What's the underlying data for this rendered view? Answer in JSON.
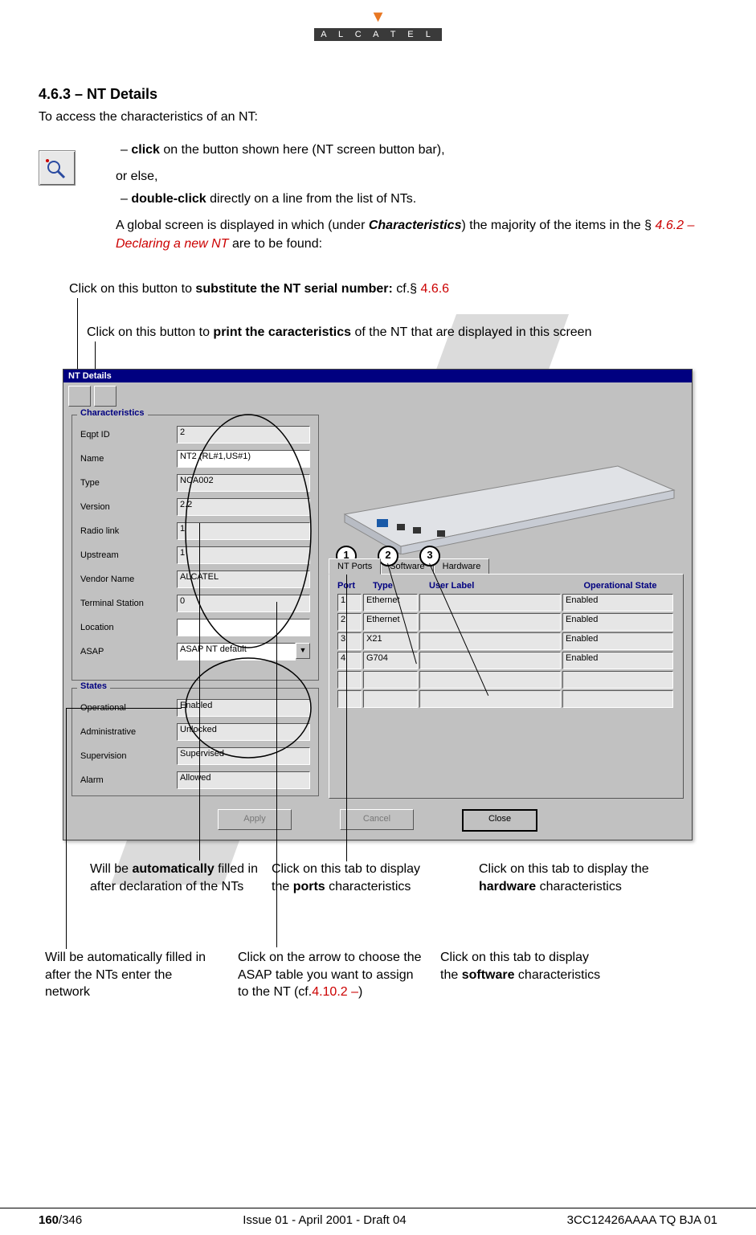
{
  "brand": "A L C A T E L",
  "section_number": "4.6.3 –  NT Details",
  "intro": "To access the characteristics of an NT:",
  "bullets": {
    "b1_prefix": "click",
    "b1_rest": " on the button shown here (NT screen button bar),",
    "or_else": "or else,",
    "b2_prefix": "double-click",
    "b2_rest": " directly on a line from the list of NTs."
  },
  "global_text_pre": "A global screen is displayed in which (under ",
  "global_text_bolditalic": "Characteristics",
  "global_text_mid": ") the majority of the items in the § ",
  "global_text_ref": "4.6.2 – Declaring a new NT",
  "global_text_post": " are to be found:",
  "callout_top1_pre": "Click on this button to ",
  "callout_top1_bold": "substitute the NT serial number:",
  "callout_top1_post": " cf.§ ",
  "callout_top1_ref": "4.6.6",
  "callout_top2_pre": "Click on this button to ",
  "callout_top2_bold": "print the caracteristics",
  "callout_top2_post": " of the NT that are displayed in this screen",
  "window": {
    "title": "NT Details",
    "characteristics_label": "Characteristics",
    "states_label": "States",
    "fields": {
      "eqpt_id": {
        "label": "Eqpt ID",
        "value": "2"
      },
      "name": {
        "label": "Name",
        "value": "NT2 (RL#1,US#1)"
      },
      "type": {
        "label": "Type",
        "value": "NCA002"
      },
      "version": {
        "label": "Version",
        "value": "2.2"
      },
      "radio_link": {
        "label": "Radio link",
        "value": "1"
      },
      "upstream": {
        "label": "Upstream",
        "value": "1"
      },
      "vendor": {
        "label": "Vendor Name",
        "value": "ALCATEL"
      },
      "terminal": {
        "label": "Terminal Station",
        "value": "0"
      },
      "location": {
        "label": "Location",
        "value": ""
      },
      "asap": {
        "label": "ASAP",
        "value": "ASAP NT default"
      }
    },
    "states": {
      "operational": {
        "label": "Operational",
        "value": "Enabled"
      },
      "administrative": {
        "label": "Administrative",
        "value": "Unlocked"
      },
      "supervision": {
        "label": "Supervision",
        "value": "Supervised"
      },
      "alarm": {
        "label": "Alarm",
        "value": "Allowed"
      }
    },
    "tabs": {
      "t1": "NT Ports",
      "t2": "Software",
      "t3": "Hardware"
    },
    "ports_header": {
      "c1": "Port",
      "c2": "Type",
      "c3": "User Label",
      "c4": "Operational State"
    },
    "ports": [
      {
        "n": "1",
        "type": "Ethernet",
        "label": "",
        "state": "Enabled"
      },
      {
        "n": "2",
        "type": "Ethernet",
        "label": "",
        "state": "Enabled"
      },
      {
        "n": "3",
        "type": "X21",
        "label": "",
        "state": "Enabled"
      },
      {
        "n": "4",
        "type": "G704",
        "label": "",
        "state": "Enabled"
      },
      {
        "n": "",
        "type": "",
        "label": "",
        "state": ""
      },
      {
        "n": "",
        "type": "",
        "label": "",
        "state": ""
      }
    ],
    "buttons": {
      "apply": "Apply",
      "cancel": "Cancel",
      "close": "Close"
    }
  },
  "badges": {
    "b1": "1",
    "b2": "2",
    "b3": "3"
  },
  "lower": {
    "auto_fill_decl_pre": "Will be ",
    "auto_fill_decl_bold": "automatically",
    "auto_fill_decl_post": " filled in after declaration of the NTs",
    "ports_tab_pre": "Click on this tab to display the ",
    "ports_tab_bold": "ports",
    "ports_tab_post": " characteristics",
    "hw_tab_pre": "Click on this tab to display the ",
    "hw_tab_bold": "hardware",
    "hw_tab_post": " characteristics",
    "auto_net": "Will be automatically filled in after the NTs enter the network",
    "asap_pre": "Click on the arrow to choose the ASAP table you want to assign to the NT (cf.",
    "asap_ref": "4.10.2 –",
    "asap_post": ")",
    "sw_tab_pre": "Click on this tab to display the ",
    "sw_tab_bold": "software",
    "sw_tab_post": " characteristics"
  },
  "footer": {
    "page": "160",
    "total": "/346",
    "center": "Issue 01 - April 2001 - Draft 04",
    "right": "3CC12426AAAA TQ BJA 01"
  }
}
